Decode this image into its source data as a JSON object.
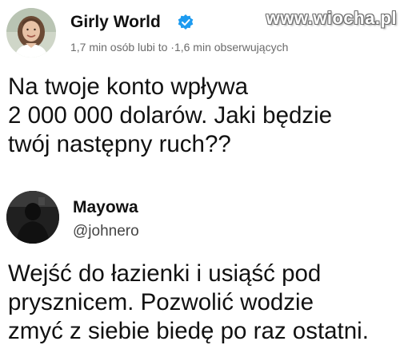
{
  "watermark": "www.wiocha.pl",
  "post1": {
    "author": {
      "name": "Girly World",
      "avatar_icon": "woman-portrait-avatar",
      "verified_icon": "verified-badge-icon",
      "verified_color": "#1d9bf0"
    },
    "meta": "1,7 min osób lubi to ·1,6 min obserwujących",
    "text_lines": [
      "Na twoje konto wpływa",
      "2 000 000 dolarów. Jaki będzie",
      "twój następny ruch??"
    ]
  },
  "post2": {
    "author": {
      "name": "Mayowa",
      "handle": "@johnero",
      "avatar_icon": "dark-figure-avatar"
    },
    "text_lines": [
      "Wejść do łazienki i usiąść pod",
      "prysznicem. Pozwolić wodzie",
      "zmyć z siebie biedę po raz ostatni."
    ]
  }
}
